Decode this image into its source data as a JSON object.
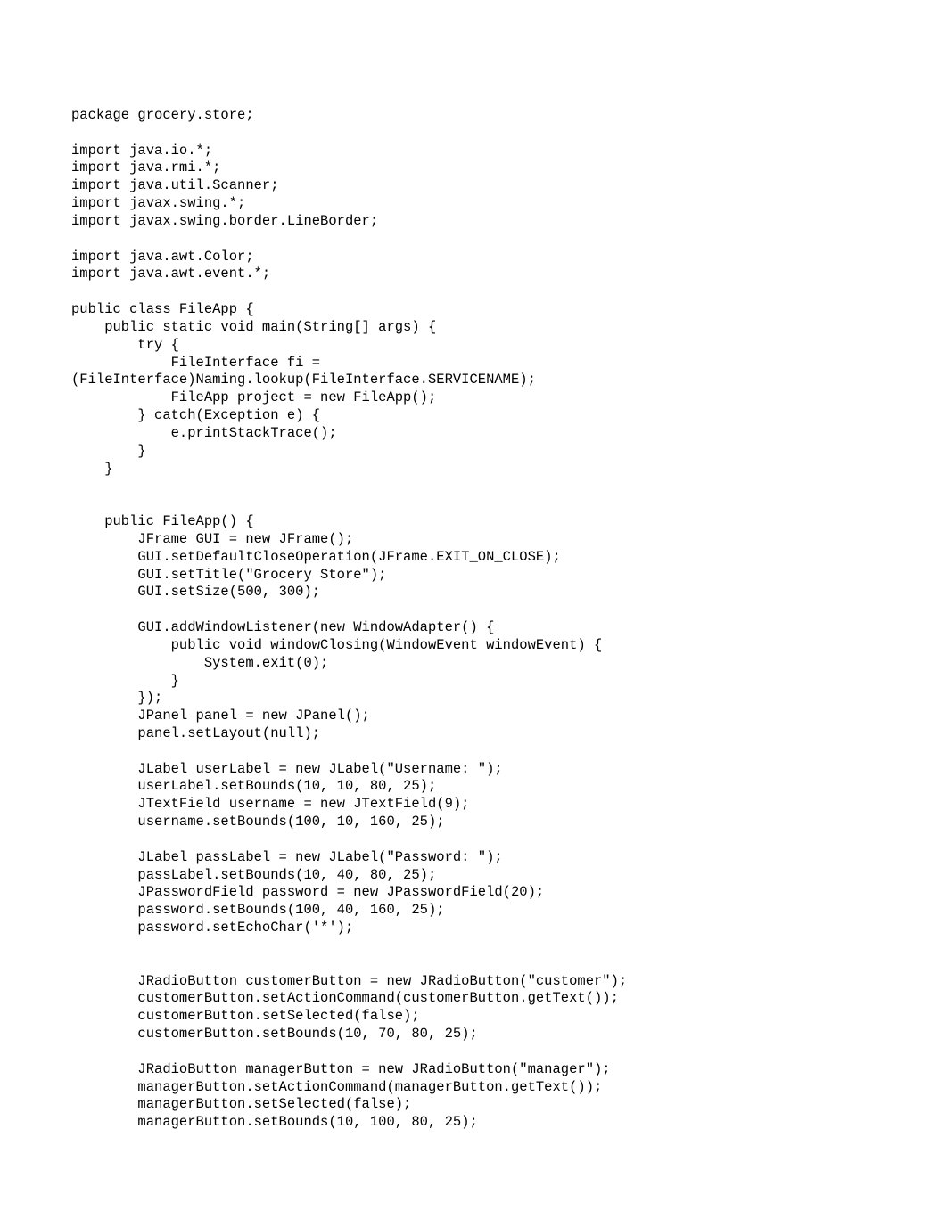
{
  "code": {
    "lines": [
      "package grocery.store;",
      "",
      "import java.io.*;",
      "import java.rmi.*;",
      "import java.util.Scanner;",
      "import javax.swing.*;",
      "import javax.swing.border.LineBorder;",
      "",
      "import java.awt.Color;",
      "import java.awt.event.*;",
      "",
      "public class FileApp {",
      "    public static void main(String[] args) {",
      "        try {",
      "            FileInterface fi =",
      "(FileInterface)Naming.lookup(FileInterface.SERVICENAME);",
      "            FileApp project = new FileApp();",
      "        } catch(Exception e) {",
      "            e.printStackTrace();",
      "        }",
      "    }",
      "",
      "",
      "    public FileApp() {",
      "        JFrame GUI = new JFrame();",
      "        GUI.setDefaultCloseOperation(JFrame.EXIT_ON_CLOSE);",
      "        GUI.setTitle(\"Grocery Store\");",
      "        GUI.setSize(500, 300);",
      "",
      "        GUI.addWindowListener(new WindowAdapter() {",
      "            public void windowClosing(WindowEvent windowEvent) {",
      "                System.exit(0);",
      "            }",
      "        });",
      "        JPanel panel = new JPanel();",
      "        panel.setLayout(null);",
      "",
      "        JLabel userLabel = new JLabel(\"Username: \");",
      "        userLabel.setBounds(10, 10, 80, 25);",
      "        JTextField username = new JTextField(9);",
      "        username.setBounds(100, 10, 160, 25);",
      "",
      "        JLabel passLabel = new JLabel(\"Password: \");",
      "        passLabel.setBounds(10, 40, 80, 25);",
      "        JPasswordField password = new JPasswordField(20);",
      "        password.setBounds(100, 40, 160, 25);",
      "        password.setEchoChar('*');",
      "",
      "",
      "        JRadioButton customerButton = new JRadioButton(\"customer\");",
      "        customerButton.setActionCommand(customerButton.getText());",
      "        customerButton.setSelected(false);",
      "        customerButton.setBounds(10, 70, 80, 25);",
      "",
      "        JRadioButton managerButton = new JRadioButton(\"manager\");",
      "        managerButton.setActionCommand(managerButton.getText());",
      "        managerButton.setSelected(false);",
      "        managerButton.setBounds(10, 100, 80, 25);"
    ]
  }
}
